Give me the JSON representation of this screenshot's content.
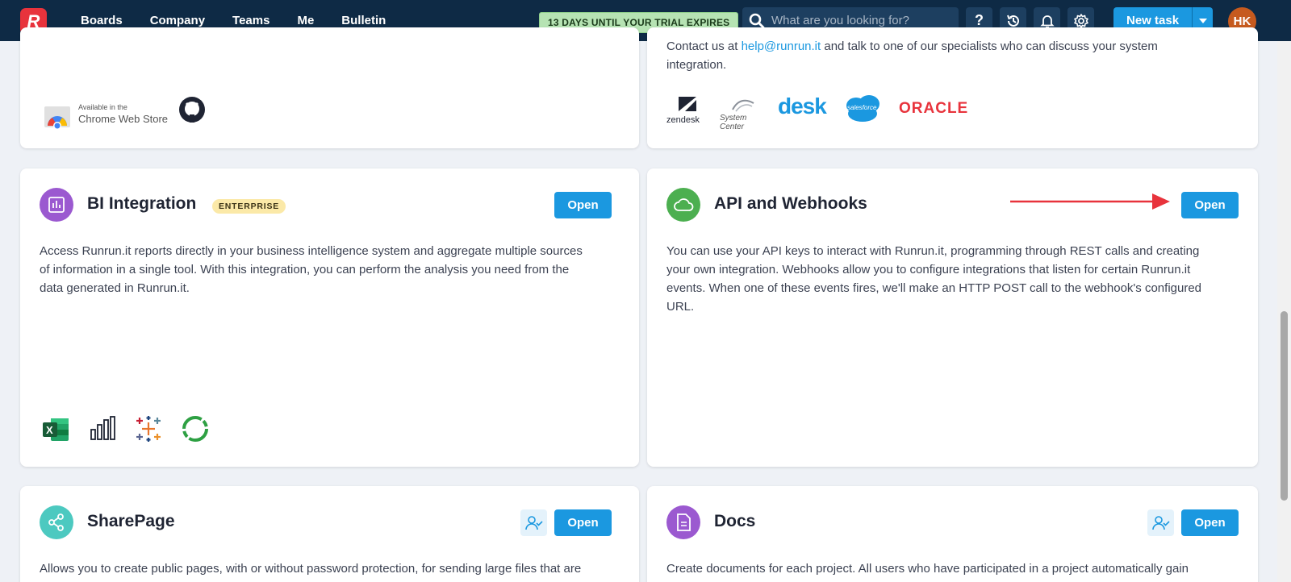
{
  "nav": {
    "logo": "R",
    "links": [
      "Boards",
      "Company",
      "Teams",
      "Me",
      "Bulletin"
    ],
    "trial": "13 DAYS UNTIL YOUR TRIAL EXPIRES",
    "search_placeholder": "What are you looking for?",
    "help": "?",
    "new_task": "New task",
    "avatar": "HK"
  },
  "cards": {
    "chrome": {
      "store_small": "Available in the",
      "store_big": "Chrome Web Store"
    },
    "enterprise": {
      "contact_prefix": "Contact us at ",
      "contact_email": "help@runrun.it",
      "contact_suffix": " and talk to one of our specialists who can discuss your system",
      "contact_line2": "integration.",
      "logos": {
        "zendesk": "zendesk",
        "system_center": "System Center",
        "desk": "desk",
        "salesforce": "salesforce",
        "oracle": "ORACLE"
      }
    },
    "bi": {
      "title": "BI Integration",
      "badge": "ENTERPRISE",
      "open": "Open",
      "desc": [
        "Access Runrun.it reports directly in your business intelligence system and aggregate multiple sources",
        "of information in a single tool. With this integration, you can perform the analysis you need from the",
        "data generated in Runrun.it."
      ],
      "excel_letter": "X"
    },
    "api": {
      "title": "API and Webhooks",
      "open": "Open",
      "desc": [
        "You can use your API keys to interact with Runrun.it, programming through REST calls and creating",
        "your own integration. Webhooks allow you to configure integrations that listen for certain Runrun.it",
        "events. When one of these events fires, we'll make an HTTP POST call to the webhook's configured",
        "URL."
      ]
    },
    "sharepage": {
      "title": "SharePage",
      "open": "Open",
      "desc": "Allows you to create public pages, with or without password protection, for sending large files that are"
    },
    "docs": {
      "title": "Docs",
      "open": "Open",
      "desc": "Create documents for each project. All users who have participated in a project automatically gain"
    }
  },
  "colors": {
    "nav_bg": "#0e2a45",
    "accent": "#1b98e0",
    "arrow": "#e8333c",
    "bi_icon": "#9b59d0",
    "api_icon": "#4caf50",
    "share_icon": "#4cc9c0",
    "docs_icon": "#9b59d0"
  }
}
